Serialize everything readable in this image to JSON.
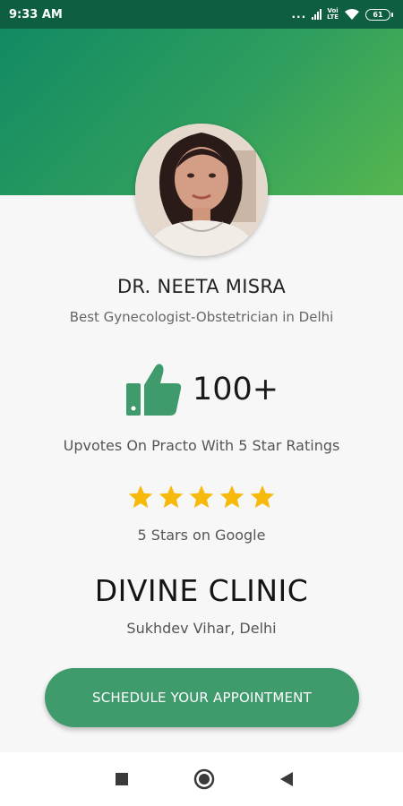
{
  "status_bar": {
    "time": "9:33 AM",
    "dots": "...",
    "network_label_top": "Voi",
    "network_label_bottom": "LTE",
    "battery": "61"
  },
  "doctor": {
    "name": "DR. NEETA MISRA",
    "title": "Best Gynecologist-Obstetrician in Delhi"
  },
  "upvotes": {
    "count": "100+",
    "label": "Upvotes On Practo With 5 Star Ratings"
  },
  "google_rating": {
    "stars": 5,
    "label": "5 Stars on Google"
  },
  "clinic": {
    "name": "DIVINE CLINIC",
    "location": "Sukhdev Vihar, Delhi"
  },
  "cta": {
    "label": "SCHEDULE YOUR APPOINTMENT"
  },
  "colors": {
    "status_bar": "#0e5e42",
    "header_start": "#128a63",
    "header_end": "#56b64f",
    "accent_green": "#3f9a6c",
    "star_yellow": "#f6b90c"
  },
  "icons": {
    "thumb": "thumbs-up-icon",
    "star": "star-icon",
    "wifi": "wifi-icon",
    "signal": "signal-icon",
    "battery": "battery-icon",
    "nav_recent": "square-icon",
    "nav_home": "circle-icon",
    "nav_back": "triangle-back-icon"
  }
}
